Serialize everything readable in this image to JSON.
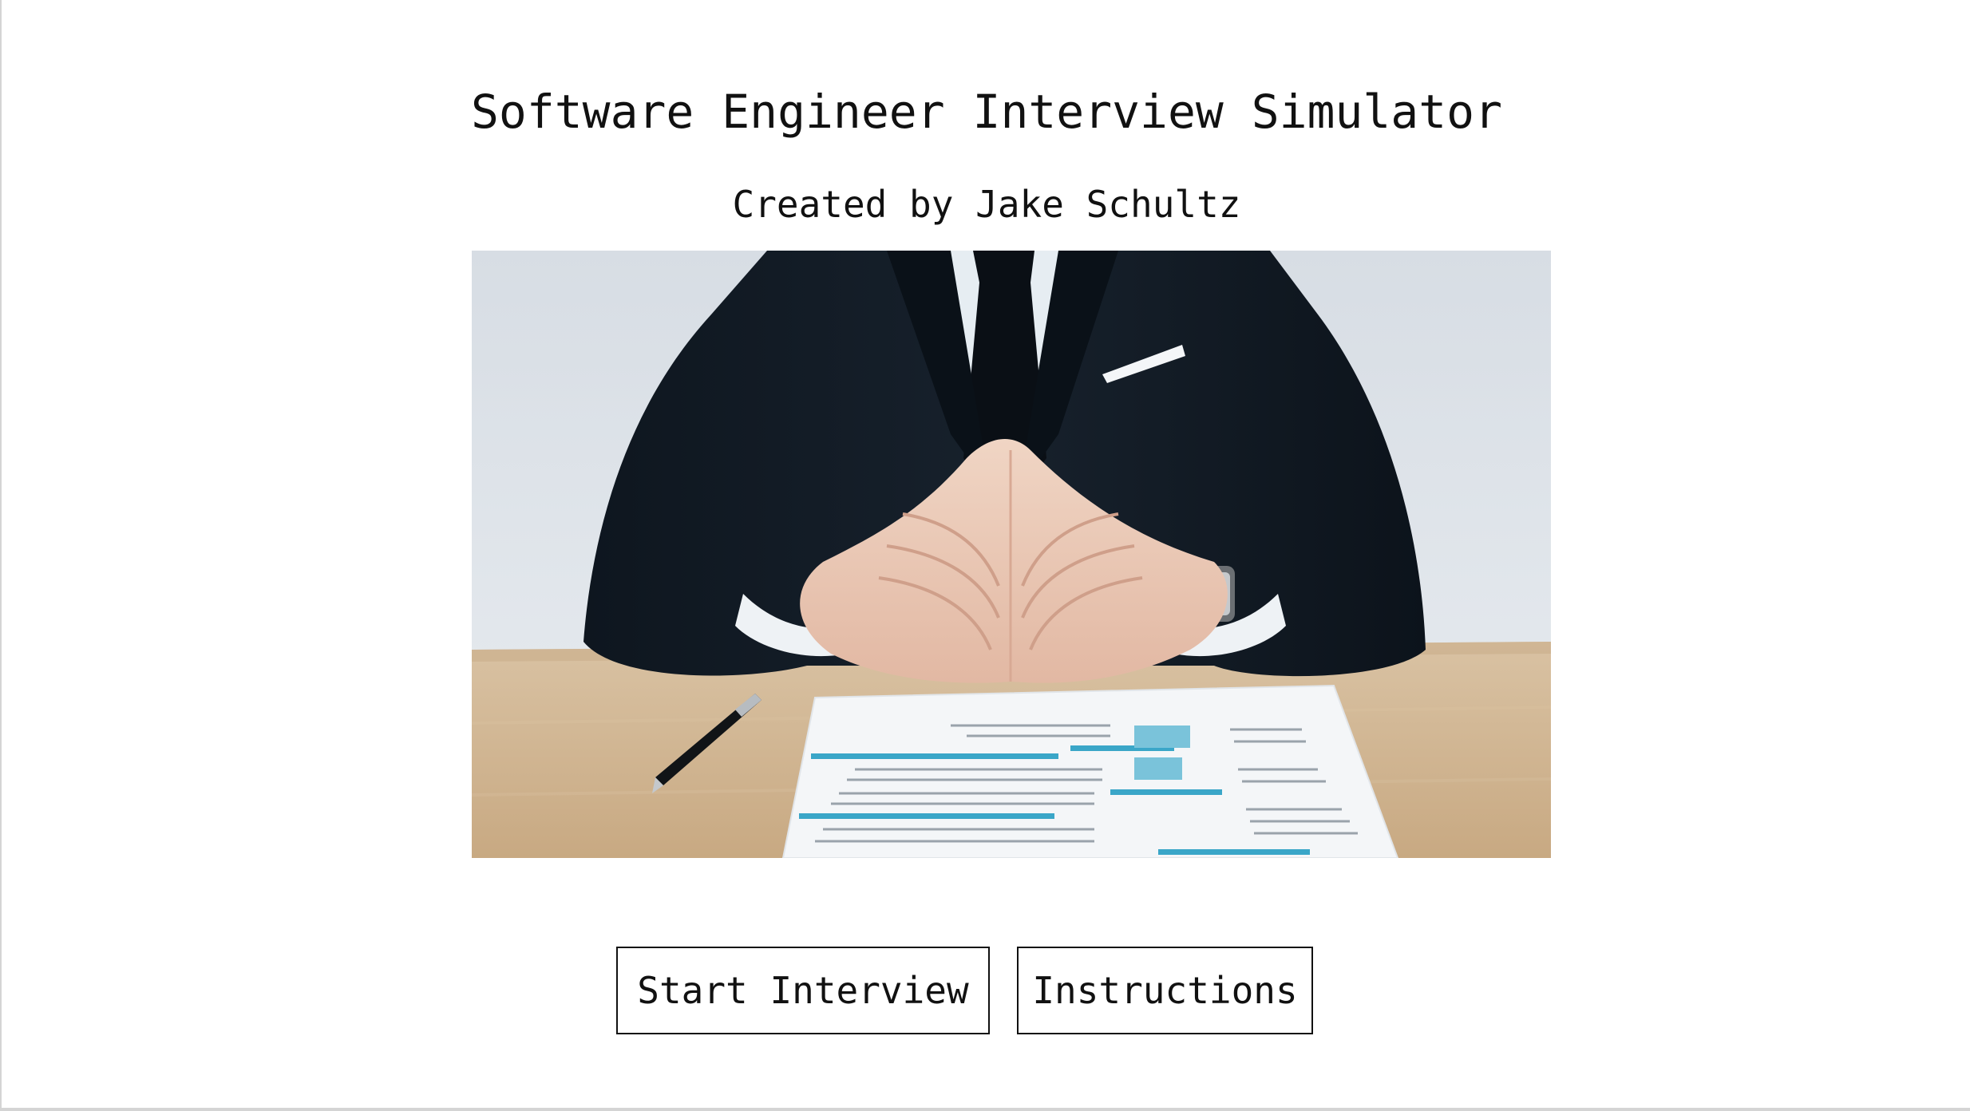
{
  "header": {
    "title": "Software Engineer Interview Simulator",
    "subtitle": "Created by Jake Schultz"
  },
  "hero_image": {
    "subject": "interviewer-at-desk-photo"
  },
  "actions": {
    "start_label": "Start Interview",
    "instructions_label": "Instructions"
  },
  "colors": {
    "background": "#ffffff",
    "text": "#111111",
    "button_border": "#111111",
    "frame_border": "#d4d4d4"
  }
}
